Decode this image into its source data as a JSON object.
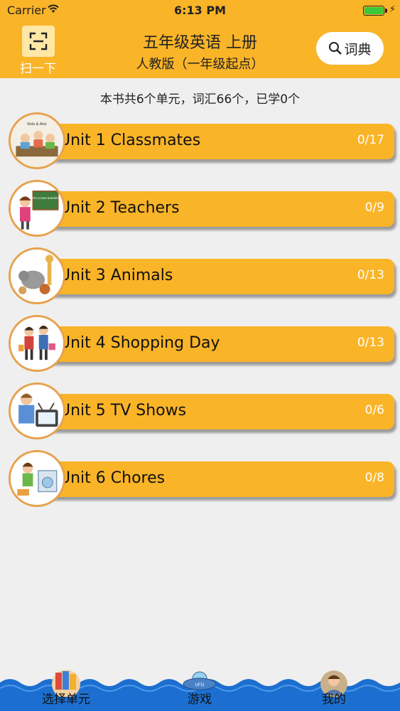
{
  "status": {
    "carrier": "Carrier",
    "time": "6:13 PM"
  },
  "header": {
    "scan_label": "扫一下",
    "title": "五年级英语 上册",
    "subtitle": "人教版（一年级起点）",
    "dict_label": "词典"
  },
  "summary": "本书共6个单元，词汇66个，已学0个",
  "units": [
    {
      "label": "Unit 1 Classmates",
      "progress": "0/17",
      "thumb_text": "Kids & Arts"
    },
    {
      "label": "Unit 2 Teachers",
      "progress": "0/9",
      "thumb_text": "I'm a new teacher"
    },
    {
      "label": "Unit 3 Animals",
      "progress": "0/13"
    },
    {
      "label": "Unit 4 Shopping Day",
      "progress": "0/13"
    },
    {
      "label": "Unit 5 TV Shows",
      "progress": "0/6"
    },
    {
      "label": "Unit 6 Chores",
      "progress": "0/8"
    }
  ],
  "tabs": [
    {
      "label": "选择单元",
      "icon": "books-icon"
    },
    {
      "label": "游戏",
      "icon": "ufo-icon",
      "icon_text": "UFO"
    },
    {
      "label": "我的",
      "icon": "profile-icon"
    }
  ],
  "colors": {
    "accent": "#f9b428",
    "background": "#efefef",
    "tab_bar": "#1c6fd0"
  }
}
